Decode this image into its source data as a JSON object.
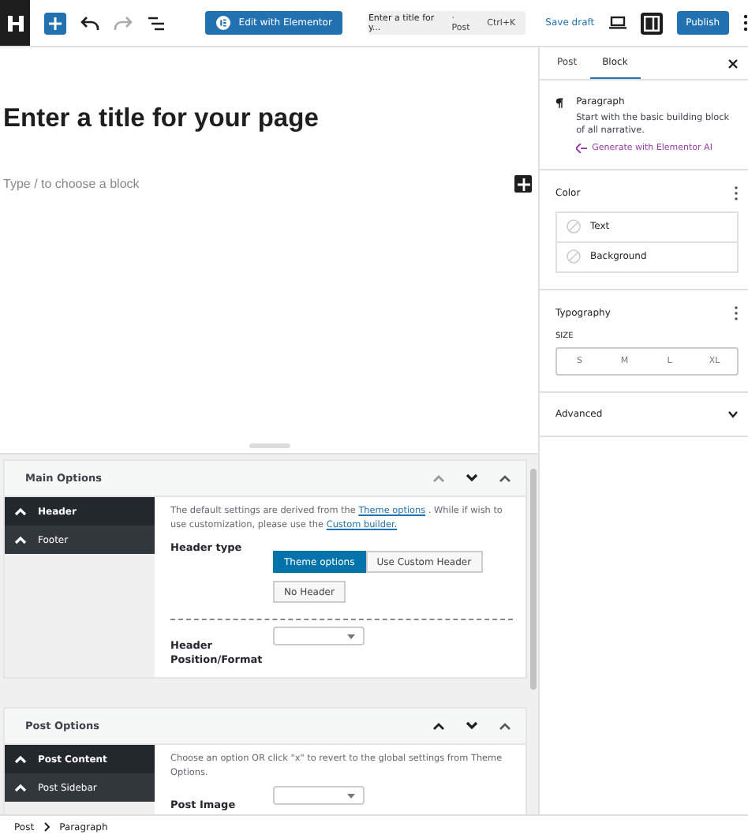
{
  "toolbar": {
    "edit_button": "Edit with Elementor",
    "command": {
      "title": "Enter a title for y...",
      "type": "· Post",
      "shortcut": "Ctrl+K"
    },
    "save_draft": "Save draft",
    "publish": "Publish",
    "sidebar_open": true
  },
  "editor": {
    "title": "Enter a title for your page",
    "placeholder": "Type / to choose a block"
  },
  "meta_boxes": [
    {
      "title": "Main Options",
      "tabs": [
        {
          "label": "Header",
          "selected": true
        },
        {
          "label": "Footer",
          "selected": false
        }
      ],
      "description": [
        {
          "kind": "text",
          "text": "The default settings are derived from the"
        },
        {
          "kind": "link",
          "text": "Theme options"
        },
        {
          "kind": "text",
          "text": ". While if wish to use customization, please use the"
        },
        {
          "kind": "link",
          "text": "Custom builder."
        }
      ],
      "fields": [
        {
          "kind": "buttons",
          "label": "Header type",
          "options": [
            {
              "label": "Theme options",
              "selected": true
            },
            {
              "label": "Use Custom Header",
              "selected": false
            },
            {
              "label": "No Header",
              "selected": false
            }
          ]
        },
        {
          "kind": "divider"
        },
        {
          "kind": "select",
          "label": "Header Position/Format"
        }
      ]
    },
    {
      "title": "Post Options",
      "tabs": [
        {
          "label": "Post Content",
          "selected": true
        },
        {
          "label": "Post Sidebar",
          "selected": false
        }
      ],
      "description": [
        {
          "kind": "text",
          "text": "Choose an option OR click \"x\" to revert to the global settings from Theme Options."
        }
      ],
      "fields": [
        {
          "kind": "select",
          "label": "Post Image"
        }
      ]
    }
  ],
  "sidebar": {
    "tabs": [
      {
        "label": "Post",
        "selected": false
      },
      {
        "label": "Block",
        "selected": true
      }
    ],
    "block": {
      "name": "Paragraph",
      "description": "Start with the basic building block of all narrative.",
      "ai_link": "Generate with Elementor AI"
    },
    "color": {
      "title": "Color",
      "items": [
        "Text",
        "Background"
      ]
    },
    "typography": {
      "title": "Typography",
      "size_label": "SIZE",
      "sizes": [
        {
          "label": "S",
          "selected": false
        },
        {
          "label": "M",
          "selected": false
        },
        {
          "label": "L",
          "selected": false
        },
        {
          "label": "XL",
          "selected": false
        }
      ]
    },
    "advanced": {
      "title": "Advanced",
      "expanded": false
    }
  },
  "breadcrumb": [
    "Post",
    "Paragraph"
  ]
}
